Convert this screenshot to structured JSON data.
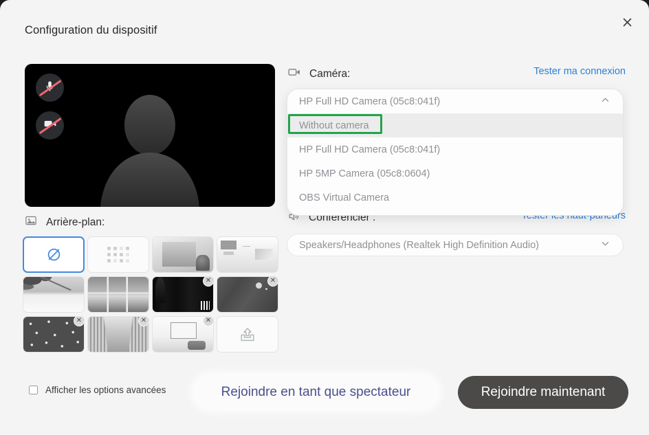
{
  "dialog": {
    "title": "Configuration du dispositif",
    "close_icon": "close-icon"
  },
  "preview": {
    "mic_status_icon": "microphone-off-icon",
    "camera_status_icon": "camera-off-icon",
    "avatar_icon": "person-silhouette-icon"
  },
  "camera": {
    "icon": "camera-icon",
    "label": "Caméra:",
    "test_link": "Tester ma connexion",
    "selected_value": "HP Full HD Camera (05c8:041f)",
    "chevron_icon": "chevron-up-icon",
    "expanded": true,
    "options": [
      {
        "label": "Without camera",
        "highlighted": true,
        "hovered": true
      },
      {
        "label": "HP Full HD Camera (05c8:041f)",
        "highlighted": false,
        "hovered": false
      },
      {
        "label": "HP 5MP Camera (05c8:0604)",
        "highlighted": false,
        "hovered": false
      },
      {
        "label": "OBS Virtual Camera",
        "highlighted": false,
        "hovered": false
      }
    ]
  },
  "speaker": {
    "icon": "speaker-icon",
    "label": "Conférencier :",
    "test_link": "Tester les haut-parleurs",
    "selected_value": "Speakers/Headphones (Realtek High Definition Audio)",
    "chevron_icon": "chevron-down-icon"
  },
  "background": {
    "icon": "image-icon",
    "label": "Arrière-plan:",
    "thumbnails": [
      {
        "name": "no-background",
        "art": "none",
        "icon": "no-background-icon",
        "selected": true,
        "removable": false
      },
      {
        "name": "blur-background",
        "art": "blur",
        "icon": "blur-icon",
        "selected": false,
        "removable": false
      },
      {
        "name": "empty-room",
        "art": "room",
        "icon": "",
        "selected": false,
        "removable": false
      },
      {
        "name": "office-shelf",
        "art": "office",
        "icon": "",
        "selected": false,
        "removable": false
      },
      {
        "name": "beach-palm",
        "art": "beach",
        "icon": "",
        "selected": false,
        "removable": false
      },
      {
        "name": "window-sea-view",
        "art": "window",
        "icon": "",
        "selected": false,
        "removable": false
      },
      {
        "name": "dark-hall",
        "art": "dark-hall",
        "icon": "",
        "selected": false,
        "removable": true
      },
      {
        "name": "dark-gradient",
        "art": "dark-grad",
        "icon": "",
        "selected": false,
        "removable": true
      },
      {
        "name": "snowflakes",
        "art": "snow",
        "icon": "",
        "selected": false,
        "removable": true
      },
      {
        "name": "library-aisle",
        "art": "library",
        "icon": "",
        "selected": false,
        "removable": true
      },
      {
        "name": "living-room",
        "art": "livingroom",
        "icon": "",
        "selected": false,
        "removable": true
      },
      {
        "name": "upload-background",
        "art": "none",
        "icon": "upload-icon",
        "selected": false,
        "removable": false
      }
    ],
    "remove_icon": "close-circle-icon"
  },
  "footer": {
    "advanced_checkbox_checked": false,
    "advanced_label": "Afficher les options avancées",
    "join_viewer_label": "Rejoindre en tant que spectateur",
    "join_now_label": "Rejoindre maintenant"
  },
  "colors": {
    "page_background": "#f4f4f4",
    "link_blue": "#2e7fd6",
    "highlight_green": "#21a44c",
    "selected_border_blue": "#4789df",
    "primary_button": "#4b4a48",
    "viewer_button_text": "#4a4f8c",
    "muted_text": "#8e9195"
  }
}
